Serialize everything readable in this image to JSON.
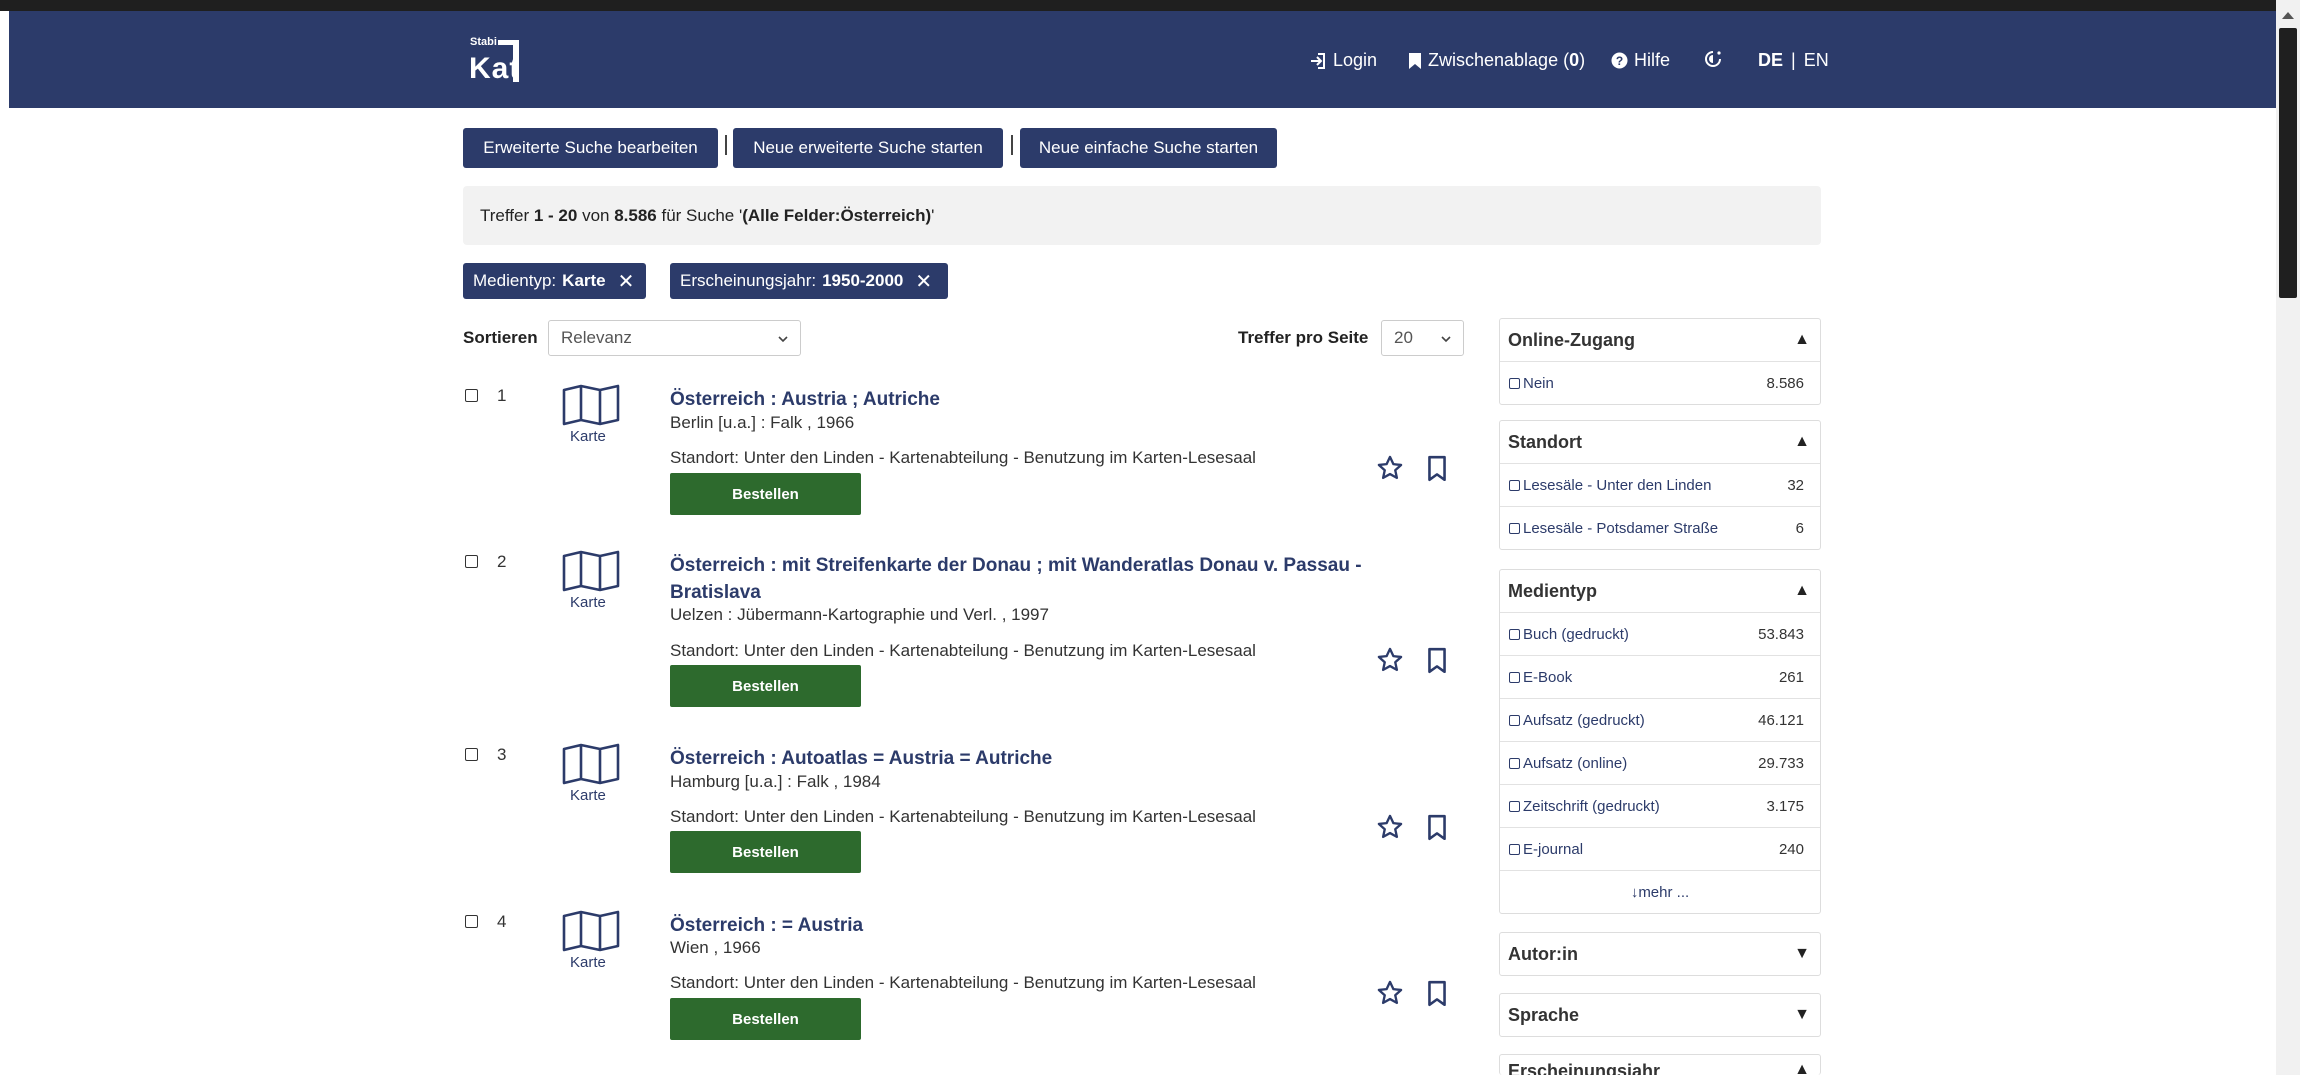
{
  "header": {
    "logo_small": "Stabi",
    "logo_big": "Kat",
    "login": "Login",
    "clipboard": "Zwischenablage",
    "clipboard_count": "0",
    "help": "Hilfe",
    "lang_de": "DE",
    "lang_sep": "|",
    "lang_en": "EN"
  },
  "actions": {
    "edit_advanced": "Erweiterte Suche bearbeiten",
    "new_advanced": "Neue erweiterte Suche starten",
    "new_simple": "Neue einfache Suche starten"
  },
  "summary": {
    "prefix": "Treffer ",
    "range": "1 - 20",
    "of": " von ",
    "total": "8.586",
    "for": " für Suche '",
    "query": "(Alle Felder:Österreich)",
    "suffix": "'"
  },
  "filters": [
    {
      "label": "Medientyp:",
      "value": "Karte"
    },
    {
      "label": "Erscheinungsjahr:",
      "value": "1950-2000"
    }
  ],
  "sort": {
    "label": "Sortieren",
    "value": "Relevanz",
    "per_page_label": "Treffer pro Seite",
    "per_page_value": "20"
  },
  "results": [
    {
      "num": "1",
      "type": "Karte",
      "title": "Österreich : Austria ; Autriche",
      "publisher": "Berlin [u.a.] : Falk , 1966",
      "location": "Standort: Unter den Linden - Kartenabteilung - Benutzung im Karten-Lesesaal",
      "order": "Bestellen"
    },
    {
      "num": "2",
      "type": "Karte",
      "title": "Österreich : mit Streifenkarte der Donau ; mit Wanderatlas Donau v. Passau - Bratislava",
      "publisher": "Uelzen : Jübermann-Kartographie und Verl. , 1997",
      "location": "Standort: Unter den Linden - Kartenabteilung - Benutzung im Karten-Lesesaal",
      "order": "Bestellen"
    },
    {
      "num": "3",
      "type": "Karte",
      "title": "Österreich : Autoatlas = Austria = Autriche",
      "publisher": "Hamburg [u.a.] : Falk , 1984",
      "location": "Standort: Unter den Linden - Kartenabteilung - Benutzung im Karten-Lesesaal",
      "order": "Bestellen"
    },
    {
      "num": "4",
      "type": "Karte",
      "title": "Österreich : = Austria",
      "publisher": "Wien , 1966",
      "location": "Standort: Unter den Linden - Kartenabteilung - Benutzung im Karten-Lesesaal",
      "order": "Bestellen"
    }
  ],
  "facets": {
    "online": {
      "title": "Online-Zugang",
      "items": [
        {
          "label": "Nein",
          "count": "8.586"
        }
      ]
    },
    "standort": {
      "title": "Standort",
      "items": [
        {
          "label": "Lesesäle - Unter den Linden",
          "count": "32"
        },
        {
          "label": "Lesesäle - Potsdamer Straße",
          "count": "6"
        }
      ]
    },
    "medientyp": {
      "title": "Medientyp",
      "items": [
        {
          "label": "Buch (gedruckt)",
          "count": "53.843"
        },
        {
          "label": "E-Book",
          "count": "261"
        },
        {
          "label": "Aufsatz (gedruckt)",
          "count": "46.121"
        },
        {
          "label": "Aufsatz (online)",
          "count": "29.733"
        },
        {
          "label": "Zeitschrift (gedruckt)",
          "count": "3.175"
        },
        {
          "label": "E-journal",
          "count": "240"
        }
      ],
      "more": "mehr ..."
    },
    "autor": {
      "title": "Autor:in"
    },
    "sprache": {
      "title": "Sprache"
    },
    "jahr": {
      "title": "Erscheinungsjahr"
    }
  },
  "colors": {
    "navy": "#2c3b6a",
    "green": "#2d6a2d"
  }
}
